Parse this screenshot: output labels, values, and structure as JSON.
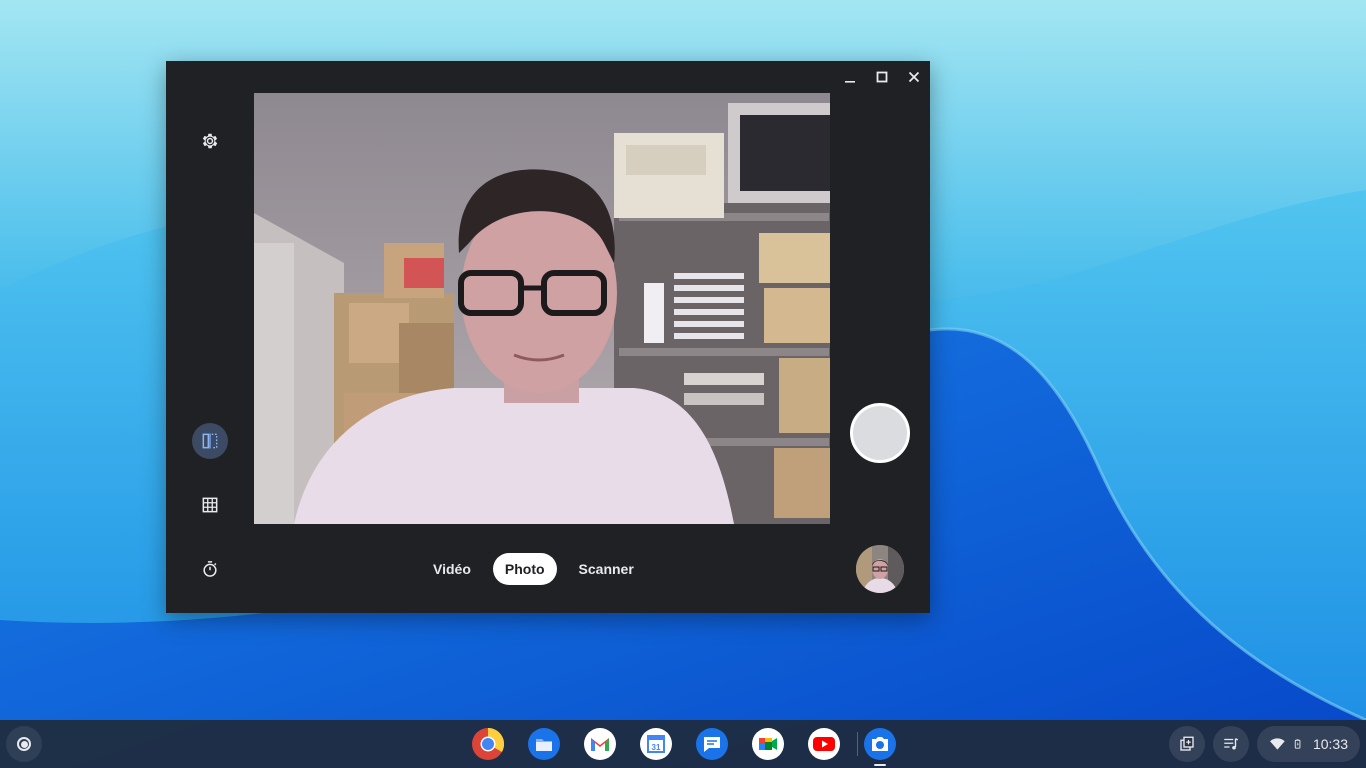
{
  "desktop": {
    "wallpaper_colors": {
      "sky_top": "#7fd8ec",
      "mid": "#2aa7e6",
      "deep": "#0b5bd8",
      "wave": "#0a57d6"
    }
  },
  "camera_app": {
    "window_controls": {
      "minimize_icon": "minimize-icon",
      "maximize_icon": "maximize-icon",
      "close_icon": "close-icon"
    },
    "left_toolbar": [
      {
        "name": "settings",
        "icon": "gear-icon"
      },
      {
        "name": "mirror",
        "icon": "mirror-flip-icon",
        "active": true
      },
      {
        "name": "grid",
        "icon": "grid-icon"
      },
      {
        "name": "timer",
        "icon": "timer-icon"
      }
    ],
    "modes": [
      {
        "label": "Vidéo",
        "selected": false
      },
      {
        "label": "Photo",
        "selected": true
      },
      {
        "label": "Scanner",
        "selected": false
      }
    ],
    "shutter_color": "#dadce0",
    "colors": {
      "window_bg": "#202124",
      "active_tool_bg": "#3c4a63",
      "text": "#e8eaed"
    }
  },
  "shelf": {
    "launcher_icon": "launcher-icon",
    "apps": [
      {
        "name": "Chrome",
        "icon": "chrome-icon"
      },
      {
        "name": "Files",
        "icon": "files-icon"
      },
      {
        "name": "Gmail",
        "icon": "gmail-icon"
      },
      {
        "name": "Calendar",
        "icon": "calendar-icon",
        "day": "31"
      },
      {
        "name": "Messages",
        "icon": "messages-icon"
      },
      {
        "name": "Meet",
        "icon": "meet-icon"
      },
      {
        "name": "YouTube",
        "icon": "youtube-icon"
      },
      {
        "name": "Camera",
        "icon": "camera-icon",
        "running": true
      }
    ],
    "tray": {
      "holding_space_icon": "holding-space-icon",
      "media_icon": "media-controls-icon",
      "wifi_icon": "wifi-icon",
      "battery_icon": "battery-icon",
      "time": "10:33"
    }
  }
}
